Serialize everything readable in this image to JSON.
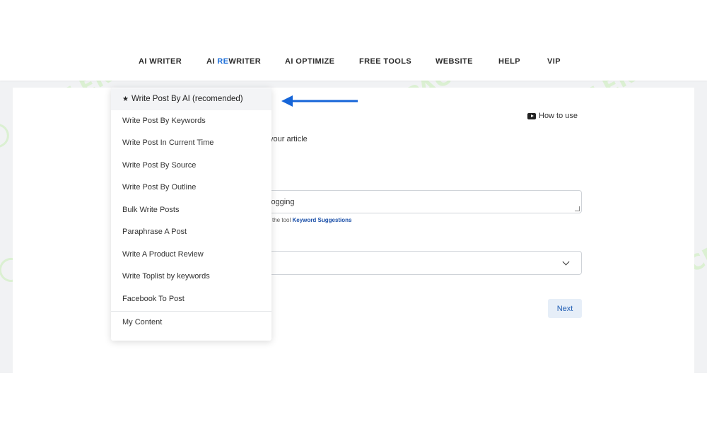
{
  "nav": {
    "items": [
      {
        "label_pre": "AI WRITER",
        "label_hl": "",
        "label_post": ""
      },
      {
        "label_pre": "AI ",
        "label_hl": "RE",
        "label_post": "WRITER"
      },
      {
        "label_pre": "AI OPTIMIZE",
        "label_hl": "",
        "label_post": ""
      },
      {
        "label_pre": "FREE TOOLS",
        "label_hl": "",
        "label_post": ""
      },
      {
        "label_pre": "WEBSITE",
        "label_hl": "",
        "label_post": ""
      },
      {
        "label_pre": "HELP",
        "label_hl": "",
        "label_post": ""
      },
      {
        "label_pre": "VIP",
        "label_hl": "",
        "label_post": ""
      }
    ],
    "highlight_color": "#1e6fd9"
  },
  "dropdown": {
    "items": [
      {
        "label": "Write Post By AI (recomended)",
        "icon": "sparkle-star-icon"
      },
      {
        "label": "Write Post By Keywords"
      },
      {
        "label": "Write Post In Current Time"
      },
      {
        "label": "Write Post By Source"
      },
      {
        "label": "Write Post By Outline"
      },
      {
        "label": "Bulk Write Posts"
      },
      {
        "label": "Paraphrase A Post"
      },
      {
        "label": "Write A Product Review"
      },
      {
        "label": "Write Toplist by keywords"
      },
      {
        "label": "Facebook To Post"
      },
      {
        "label": "My Content"
      }
    ]
  },
  "main": {
    "how_to_use": "How to use",
    "hint_partial": "your article",
    "keyword_value_partial": "logging",
    "tool_note_partial": "the tool",
    "tool_note_link": "Keyword Suggestions",
    "next_label": "Next"
  },
  "watermark": {
    "text": "AI TALENT SPACE",
    "color": "#8ce65a"
  },
  "annotation": {
    "arrow_color": "#1565d8",
    "icon": "left-arrow-icon"
  }
}
